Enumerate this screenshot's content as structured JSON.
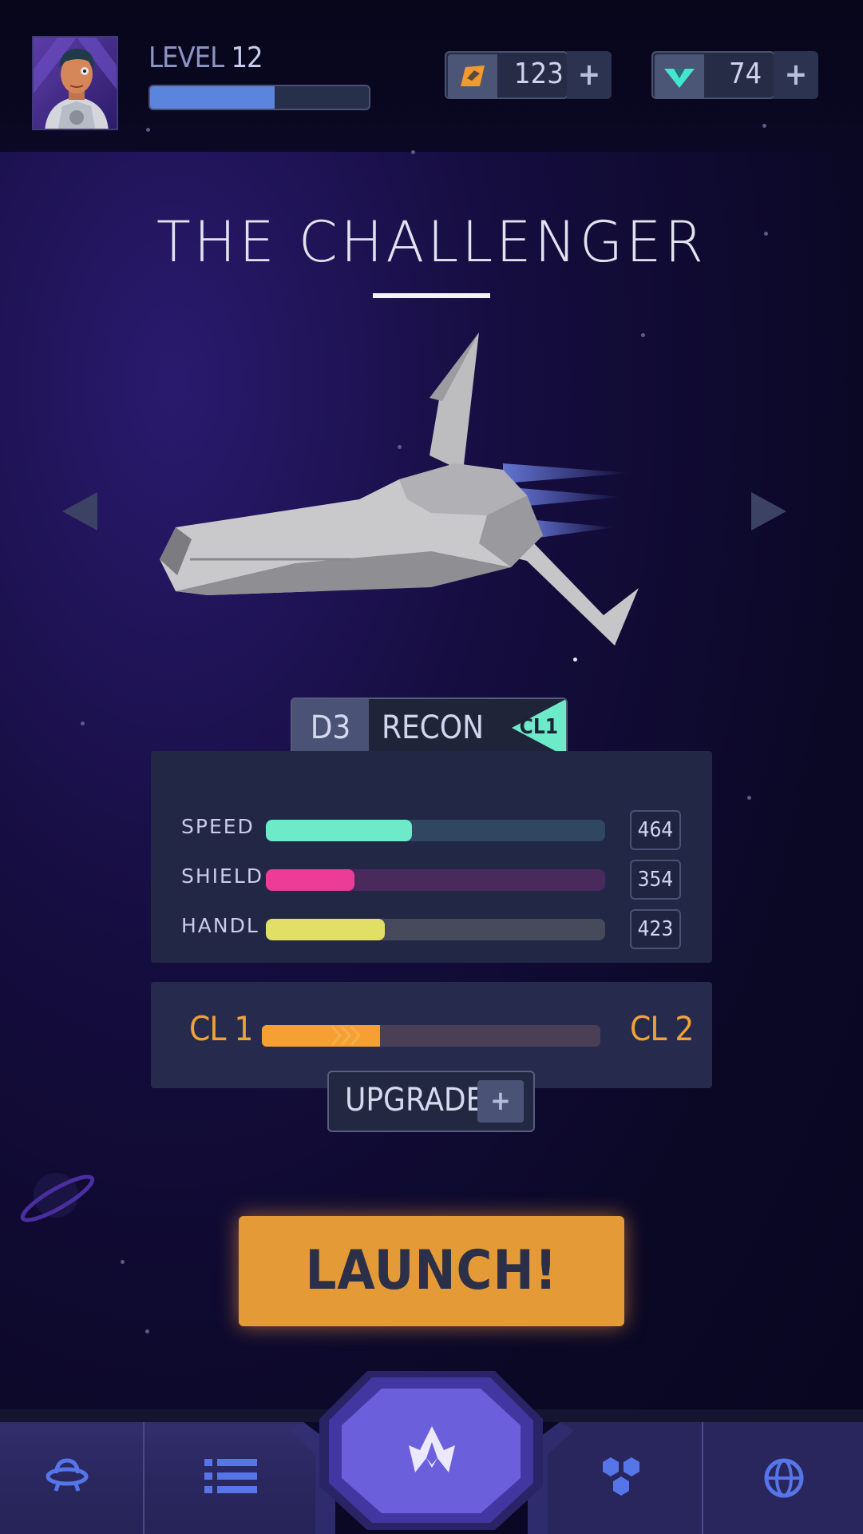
{
  "player": {
    "level_prefix": "LEVEL",
    "level_number": "12",
    "xp_progress": 0.57
  },
  "currency": {
    "coins": {
      "icon": "coin-icon",
      "value": "123",
      "add": "+"
    },
    "gems": {
      "icon": "gem-icon",
      "value": "74",
      "add": "+"
    }
  },
  "ship": {
    "name": "THE CHALLENGER",
    "tier": "D3",
    "role": "RECON",
    "class_badge": "CL1",
    "prev_icon": "triangle-left-icon",
    "next_icon": "triangle-right-icon"
  },
  "stats": [
    {
      "label": "SPEED",
      "value": "464",
      "fill": 0.43,
      "color": "#6deac8",
      "track": "#2f4760"
    },
    {
      "label": "SHIELD",
      "value": "354",
      "fill": 0.26,
      "color": "#ec3c95",
      "track": "#4a2a5c"
    },
    {
      "label": "HANDL",
      "value": "423",
      "fill": 0.35,
      "color": "#e2df66",
      "track": "#474a5a"
    }
  ],
  "class_progress": {
    "from": "CL 1",
    "to": "CL 2",
    "fill": 0.35
  },
  "upgrade": {
    "label": "UPGRADE",
    "plus": "+"
  },
  "launch": {
    "label": "LAUNCH!"
  },
  "nav": [
    {
      "name": "nav-ships",
      "icon": "ufo-icon"
    },
    {
      "name": "nav-list",
      "icon": "list-icon"
    },
    {
      "name": "nav-hangar",
      "icon": "ship-icon"
    },
    {
      "name": "nav-upgrades",
      "icon": "hexagons-icon"
    },
    {
      "name": "nav-world",
      "icon": "globe-icon"
    }
  ],
  "colors": {
    "accent_orange": "#e49a37",
    "accent_teal": "#6deac8",
    "accent_pink": "#ec3c95",
    "accent_yellow": "#e2df66",
    "nav_icon": "#5575e8"
  }
}
